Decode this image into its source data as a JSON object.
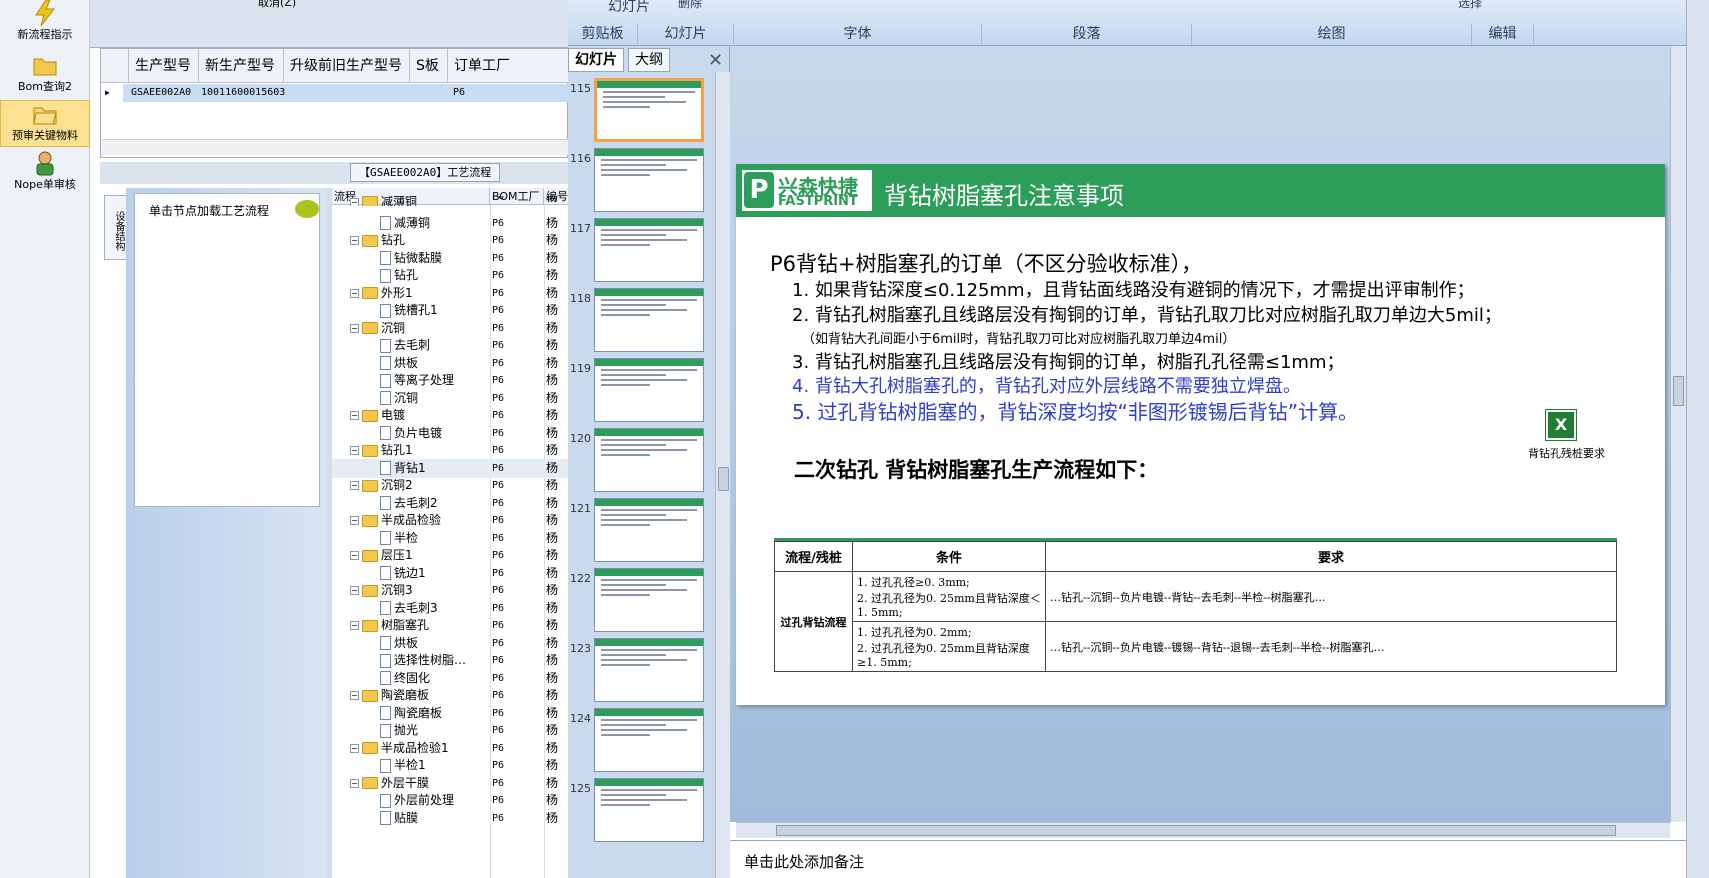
{
  "sidebar": {
    "items": [
      {
        "label": "新流程指示",
        "icon": "lightning-icon"
      },
      {
        "label": "Bom查询2",
        "icon": "folder-icon"
      },
      {
        "label": "预审关键物料",
        "icon": "folder-open-icon"
      },
      {
        "label": "Nope单审核",
        "icon": "user-icon"
      }
    ]
  },
  "toolbar": {
    "cancel_label": "取消(Z)"
  },
  "grid": {
    "columns": [
      "生产型号",
      "新生产型号",
      "升级前旧生产型号",
      "S板",
      "订单工厂"
    ],
    "rows": [
      [
        "GSAEE002A0",
        "10011600015603",
        "",
        "",
        "P6"
      ]
    ]
  },
  "process": {
    "title": "【GSAEE002A0】工艺流程",
    "vertical_tab": "设备结构",
    "hint": "单击节点加载工艺流程",
    "tree_headers": [
      "流程",
      "BOM工厂",
      "编号"
    ],
    "rows": [
      {
        "name": "减薄铜",
        "level": 1,
        "bom": "P6",
        "editor": "杨",
        "folder": true,
        "partial": true
      },
      {
        "name": "减薄铜",
        "level": 2,
        "bom": "P6",
        "editor": "杨"
      },
      {
        "name": "钻孔",
        "level": 1,
        "bom": "P6",
        "editor": "杨",
        "folder": true
      },
      {
        "name": "钻微黏膜",
        "level": 2,
        "bom": "P6",
        "editor": "杨"
      },
      {
        "name": "钻孔",
        "level": 2,
        "bom": "P6",
        "editor": "杨"
      },
      {
        "name": "外形1",
        "level": 1,
        "bom": "P6",
        "editor": "杨",
        "folder": true
      },
      {
        "name": "铣槽孔1",
        "level": 2,
        "bom": "P6",
        "editor": "杨"
      },
      {
        "name": "沉铜",
        "level": 1,
        "bom": "P6",
        "editor": "杨",
        "folder": true
      },
      {
        "name": "去毛刺",
        "level": 2,
        "bom": "P6",
        "editor": "杨"
      },
      {
        "name": "烘板",
        "level": 2,
        "bom": "P6",
        "editor": "杨"
      },
      {
        "name": "等离子处理",
        "level": 2,
        "bom": "P6",
        "editor": "杨"
      },
      {
        "name": "沉铜",
        "level": 2,
        "bom": "P6",
        "editor": "杨"
      },
      {
        "name": "电镀",
        "level": 1,
        "bom": "P6",
        "editor": "杨",
        "folder": true
      },
      {
        "name": "负片电镀",
        "level": 2,
        "bom": "P6",
        "editor": "杨"
      },
      {
        "name": "钻孔1",
        "level": 1,
        "bom": "P6",
        "editor": "杨",
        "folder": true
      },
      {
        "name": "背钻1",
        "level": 2,
        "bom": "P6",
        "editor": "杨",
        "selected": true
      },
      {
        "name": "沉铜2",
        "level": 1,
        "bom": "P6",
        "editor": "杨",
        "folder": true
      },
      {
        "name": "去毛刺2",
        "level": 2,
        "bom": "P6",
        "editor": "杨"
      },
      {
        "name": "半成品检验",
        "level": 1,
        "bom": "P6",
        "editor": "杨",
        "folder": true
      },
      {
        "name": "半检",
        "level": 2,
        "bom": "P6",
        "editor": "杨"
      },
      {
        "name": "层压1",
        "level": 1,
        "bom": "P6",
        "editor": "杨",
        "folder": true
      },
      {
        "name": "铣边1",
        "level": 2,
        "bom": "P6",
        "editor": "杨"
      },
      {
        "name": "沉铜3",
        "level": 1,
        "bom": "P6",
        "editor": "杨",
        "folder": true
      },
      {
        "name": "去毛刺3",
        "level": 2,
        "bom": "P6",
        "editor": "杨"
      },
      {
        "name": "树脂塞孔",
        "level": 1,
        "bom": "P6",
        "editor": "杨",
        "folder": true
      },
      {
        "name": "烘板",
        "level": 2,
        "bom": "P6",
        "editor": "杨"
      },
      {
        "name": "选择性树脂…",
        "level": 2,
        "bom": "P6",
        "editor": "杨"
      },
      {
        "name": "终固化",
        "level": 2,
        "bom": "P6",
        "editor": "杨"
      },
      {
        "name": "陶瓷磨板",
        "level": 1,
        "bom": "P6",
        "editor": "杨",
        "folder": true
      },
      {
        "name": "陶瓷磨板",
        "level": 2,
        "bom": "P6",
        "editor": "杨"
      },
      {
        "name": "抛光",
        "level": 2,
        "bom": "P6",
        "editor": "杨"
      },
      {
        "name": "半成品检验1",
        "level": 1,
        "bom": "P6",
        "editor": "杨",
        "folder": true
      },
      {
        "name": "半检1",
        "level": 2,
        "bom": "P6",
        "editor": "杨"
      },
      {
        "name": "外层干膜",
        "level": 1,
        "bom": "P6",
        "editor": "杨",
        "folder": true
      },
      {
        "name": "外层前处理",
        "level": 2,
        "bom": "P6",
        "editor": "杨"
      },
      {
        "name": "贴膜",
        "level": 2,
        "bom": "P6",
        "editor": "杨"
      }
    ]
  },
  "ribbon": {
    "slides_button": "幻灯片",
    "delete_button": "删除",
    "select_button": "选择",
    "groups": [
      "剪贴板",
      "幻灯片",
      "字体",
      "段落",
      "绘图",
      "编辑"
    ]
  },
  "slides_pane": {
    "tabs": [
      "幻灯片",
      "大纲"
    ],
    "close": "✕",
    "thumbnails": [
      "115",
      "116",
      "117",
      "118",
      "119",
      "120",
      "121",
      "122",
      "123",
      "124",
      "125"
    ],
    "selected": "115"
  },
  "slide": {
    "logo_cn": "兴森快捷",
    "logo_en": "FASTPRINT",
    "title": "背钻树脂塞孔注意事项",
    "heading": "P6背钻+树脂塞孔的订单（不区分验收标准），",
    "items": [
      "1. 如果背钻深度≤0.125mm，且背钻面线路没有避铜的情况下，才需提出评审制作；",
      "2. 背钻孔树脂塞孔且线路层没有掏铜的订单，背钻孔取刀比对应树脂孔取刀单边大5mil；",
      "（如背钻大孔间距小于6mil时，背钻孔取刀可比对应树脂孔取刀单边4mil）",
      "3. 背钻孔树脂塞孔且线路层没有掏铜的订单，树脂孔孔径需≤1mm；",
      "4. 背钻大孔树脂塞孔的，背钻孔对应外层线路不需要独立焊盘。",
      "5. 过孔背钻树脂塞的，背钻深度均按“非图形镀锡后背钻”计算。"
    ],
    "attachment": "背钻孔残桩要求",
    "subheading": "二次钻孔 背钻树脂塞孔生产流程如下：",
    "table": {
      "headers": [
        "流程/残桩",
        "条件",
        "要求"
      ],
      "row_label": "过孔背钻流程",
      "rows": [
        {
          "cond1": "1. 过孔孔径≥0. 3mm;",
          "cond2": "2. 过孔孔径为0. 25mm且背钻深度＜1. 5mm;",
          "req": "…钻孔--沉铜--负片电镀--背钻--去毛刺--半检--树脂塞孔…"
        },
        {
          "cond1": "1. 过孔孔径为0. 2mm;",
          "cond2": "2. 过孔孔径为0. 25mm且背钻深度≥1. 5mm;",
          "req": "…钻孔--沉铜--负片电镀--镀锡--背钻--退锡--去毛刺--半检--树脂塞孔…"
        }
      ]
    }
  },
  "notes": {
    "placeholder": "单击此处添加备注"
  },
  "colors": {
    "accent_green": "#2d9e5a",
    "blue_text": "#2f3fcc",
    "selection": "#fbe191"
  }
}
